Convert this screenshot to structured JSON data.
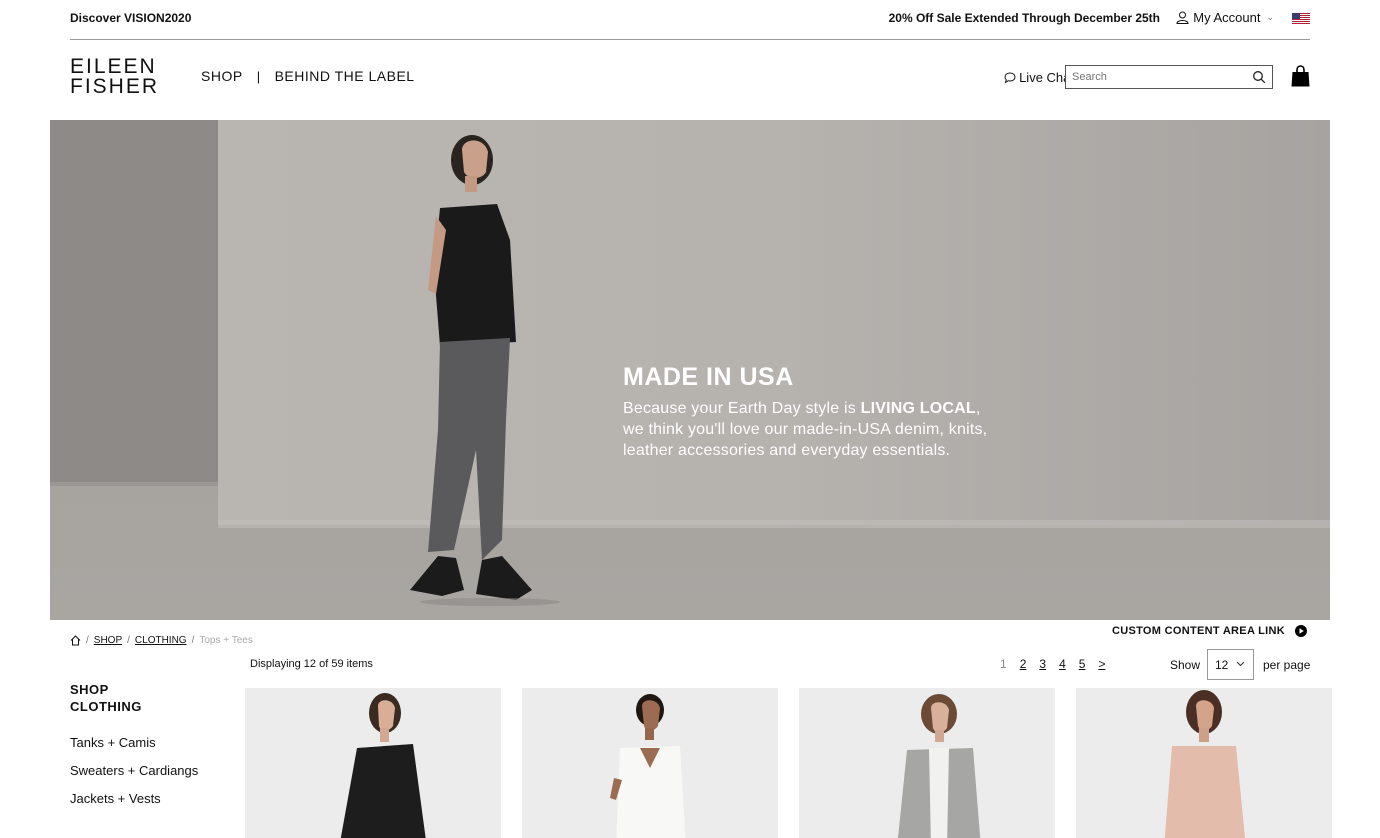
{
  "topbar": {
    "discover": "Discover VISION2020",
    "promo": "20% Off Sale Extended Through December 25th",
    "account": "My Account"
  },
  "header": {
    "logo_line1": "EILEEN",
    "logo_line2": "FISHER",
    "nav": [
      "SHOP",
      "BEHIND THE LABEL"
    ],
    "nav_separator": "|",
    "live_chat": "Live Chat",
    "search_placeholder": "Search"
  },
  "hero": {
    "title": "MADE IN USA",
    "line1_prefix": "Because your Earth Day style is ",
    "line1_bold": "LIVING LOCAL",
    "line1_suffix": ",",
    "line2": "we think you'll love our made-in-USA denim, knits,",
    "line3": "leather accessories and everyday essentials."
  },
  "breadcrumb": {
    "sep": "/",
    "items": [
      "SHOP",
      "CLOTHING"
    ],
    "current": "Tops + Tees"
  },
  "custom_link": "CUSTOM CONTENT AREA LINK",
  "listing": {
    "displaying": "Displaying 12 of 59 items",
    "pages": [
      "1",
      "2",
      "3",
      "4",
      "5",
      ">"
    ],
    "show_label": "Show",
    "per_page_value": "12",
    "per_page_label": "per page"
  },
  "sidebar": {
    "heading_line1": "SHOP",
    "heading_line2": "CLOTHING",
    "items": [
      "Tanks + Camis",
      "Sweaters + Cardiangs",
      "Jackets + Vests"
    ]
  },
  "icons": {
    "account": "person-icon",
    "flag": "us-flag-icon",
    "chat": "speech-bubble-icon",
    "search": "search-icon",
    "bag": "shopping-bag-icon",
    "home": "home-icon",
    "play": "play-circle-icon"
  },
  "colors": {
    "text": "#111111",
    "hero_bg": "#a9a6a3",
    "product_bg": "#ececec"
  }
}
